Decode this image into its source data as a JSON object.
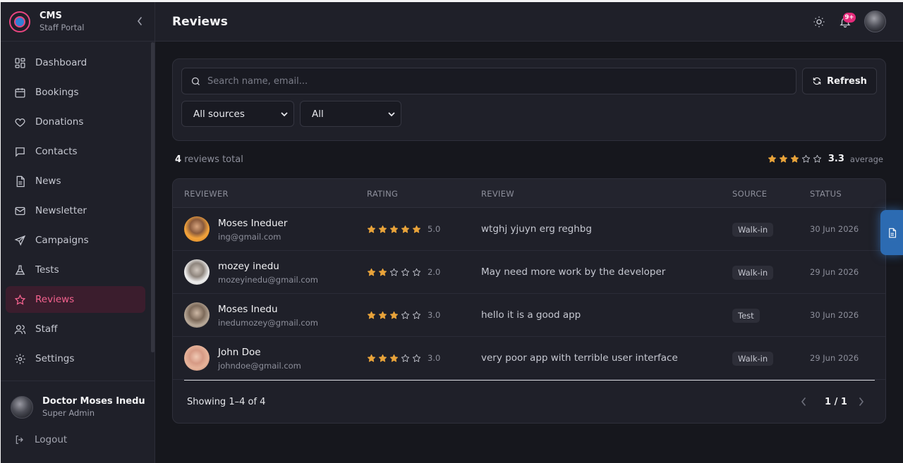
{
  "brand": {
    "title": "CMS",
    "subtitle": "Staff Portal"
  },
  "sidebar": {
    "items": [
      {
        "label": "Dashboard",
        "icon": "dashboard-icon"
      },
      {
        "label": "Bookings",
        "icon": "calendar-icon"
      },
      {
        "label": "Donations",
        "icon": "heart-icon"
      },
      {
        "label": "Contacts",
        "icon": "chat-icon"
      },
      {
        "label": "News",
        "icon": "document-icon"
      },
      {
        "label": "Newsletter",
        "icon": "mail-icon"
      },
      {
        "label": "Campaigns",
        "icon": "send-icon"
      },
      {
        "label": "Tests",
        "icon": "flask-icon"
      },
      {
        "label": "Reviews",
        "icon": "star-icon",
        "active": true
      },
      {
        "label": "Staff",
        "icon": "users-icon"
      },
      {
        "label": "Settings",
        "icon": "gear-icon"
      }
    ],
    "user": {
      "name": "Doctor Moses Inedu",
      "role": "Super Admin"
    },
    "logout_label": "Logout"
  },
  "header": {
    "title": "Reviews",
    "notification_badge": "9+"
  },
  "filters": {
    "search_placeholder": "Search name, email...",
    "refresh_label": "Refresh",
    "source_selected": "All sources",
    "status_selected": "All"
  },
  "summary": {
    "total_count": "4",
    "total_label": "reviews total",
    "average_value": "3.3",
    "average_rating": 3.3,
    "average_label": "average"
  },
  "table": {
    "columns": [
      "REVIEWER",
      "RATING",
      "REVIEW",
      "SOURCE",
      "STATUS"
    ],
    "rows": [
      {
        "name": "Moses Ineduer",
        "email": "ing@gmail.com",
        "rating": 5,
        "rating_label": "5.0",
        "review": "wtghj yjuyn erg reghbg",
        "source": "Walk-in",
        "status": "30 Jun 2026"
      },
      {
        "name": "mozey inedu",
        "email": "mozeyinedu@gmail.com",
        "rating": 2,
        "rating_label": "2.0",
        "review": "May need more work by the developer",
        "source": "Walk-in",
        "status": "29 Jun 2026"
      },
      {
        "name": "Moses Inedu",
        "email": "inedumozey@gmail.com",
        "rating": 3,
        "rating_label": "3.0",
        "review": "hello it is a good app",
        "source": "Test",
        "status": "30 Jun 2026"
      },
      {
        "name": "John Doe",
        "email": "johndoe@gmail.com",
        "rating": 3,
        "rating_label": "3.0",
        "review": "very poor app with terrible user interface",
        "source": "Walk-in",
        "status": "29 Jun 2026"
      }
    ]
  },
  "pager": {
    "showing": "Showing 1–4 of 4",
    "page": "1 / 1"
  },
  "colors": {
    "accent": "#f3628e",
    "star": "#e8a33a",
    "background": "#16171d",
    "panel": "#1f2029"
  }
}
